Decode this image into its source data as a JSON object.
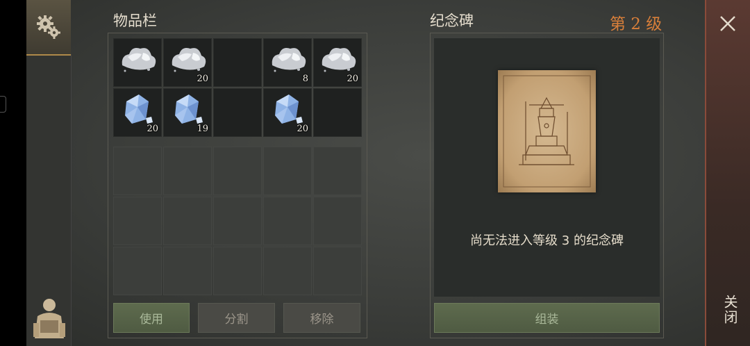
{
  "inventory": {
    "title": "物品栏",
    "items": [
      {
        "type": "ore-pile",
        "qty": ""
      },
      {
        "type": "ore-pile",
        "qty": "20"
      },
      {
        "type": "empty",
        "qty": ""
      },
      {
        "type": "ore-pile",
        "qty": "8"
      },
      {
        "type": "ore-pile",
        "qty": "20"
      },
      {
        "type": "crystal",
        "qty": "20"
      },
      {
        "type": "crystal",
        "qty": "19"
      },
      {
        "type": "empty",
        "qty": ""
      },
      {
        "type": "crystal",
        "qty": "20"
      },
      {
        "type": "empty",
        "qty": ""
      }
    ],
    "buttons": {
      "use": "使用",
      "split": "分割",
      "remove": "移除"
    }
  },
  "monument": {
    "title": "纪念碑",
    "level_label": "第 2 级",
    "message": "尚无法进入等级 3 的纪念碑",
    "assemble_button": "组装"
  },
  "close": {
    "label": "关闭"
  },
  "icons": {
    "settings": "gear-icon",
    "character": "character-icon",
    "close": "close-icon",
    "ore": "stone-ore-icon",
    "crystal": "crystal-icon",
    "blueprint": "monument-blueprint"
  }
}
